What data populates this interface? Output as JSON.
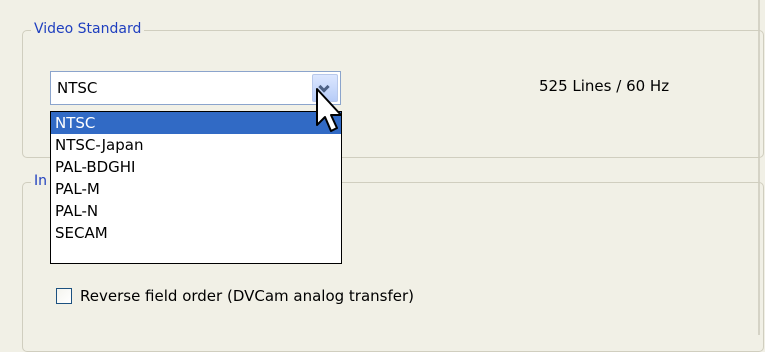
{
  "video_standard_group": {
    "title": "Video Standard",
    "selected_value": "NTSC",
    "info": "525 Lines / 60 Hz",
    "options": [
      {
        "label": "NTSC",
        "selected": true
      },
      {
        "label": "NTSC-Japan",
        "selected": false
      },
      {
        "label": "PAL-BDGHI",
        "selected": false
      },
      {
        "label": "PAL-M",
        "selected": false
      },
      {
        "label": "PAL-N",
        "selected": false
      },
      {
        "label": "SECAM",
        "selected": false
      }
    ]
  },
  "second_group": {
    "title_visible": "In"
  },
  "checkbox": {
    "label": "Reverse field order (DVCam analog transfer)",
    "checked": false
  },
  "icons": {
    "dropdown_arrow": "chevron-down-icon",
    "cursor": "mouse-cursor-icon"
  },
  "colors": {
    "accent": "#316ac5",
    "group_title": "#1f3fbf",
    "background": "#f1f0e6"
  }
}
